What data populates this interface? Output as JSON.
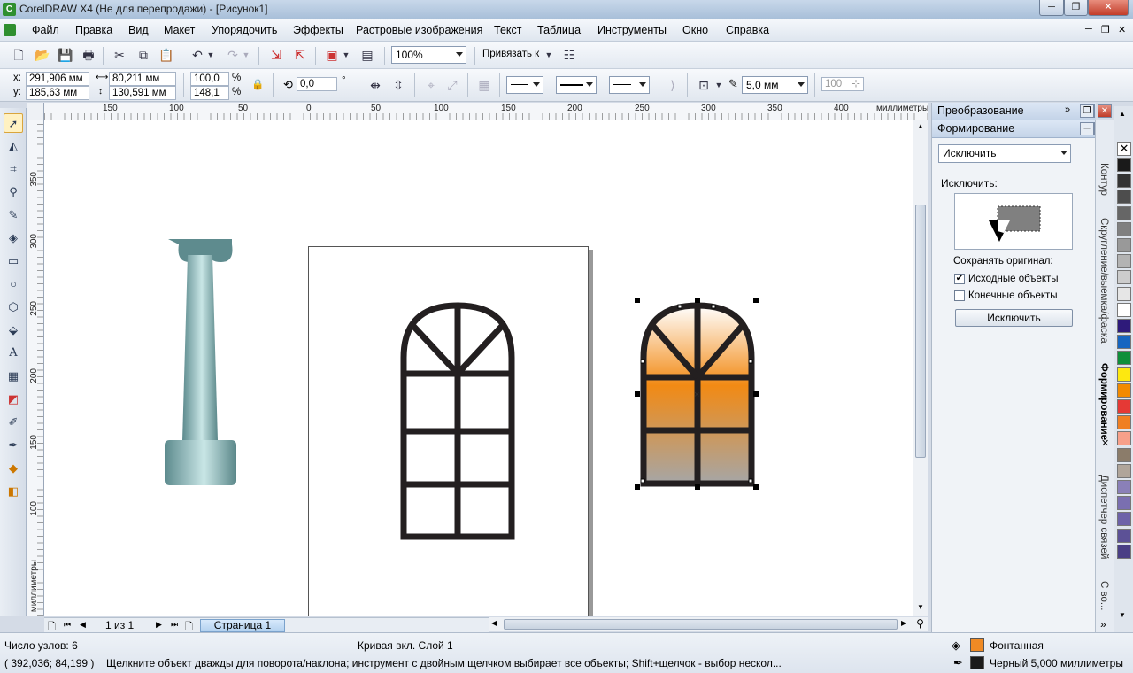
{
  "window": {
    "title": "CorelDRAW X4 (Не для перепродажи) - [Рисунок1]",
    "controls": [
      "─",
      "❐",
      "✕"
    ],
    "doc_controls": [
      "─",
      "❐",
      "✕"
    ]
  },
  "menu": [
    "Файл",
    "Правка",
    "Вид",
    "Макет",
    "Упорядочить",
    "Эффекты",
    "Растровые изображения",
    "Текст",
    "Таблица",
    "Инструменты",
    "Окно",
    "Справка"
  ],
  "toolbar": {
    "zoom": "100%",
    "snap_label": "Привязать к"
  },
  "property_bar": {
    "x_label": "x:",
    "x_value": "291,906 мм",
    "y_label": "y:",
    "y_value": "185,63 мм",
    "width_value": "80,211 мм",
    "height_value": "130,591 мм",
    "scale_x": "100,0",
    "scale_y": "148,1",
    "percent": "%",
    "rotation": "0,0",
    "degree": "°",
    "outline_width": "5,0 мм",
    "corner_value": "100"
  },
  "ruler": {
    "top_ticks": [
      "150",
      "100",
      "50",
      "0",
      "50",
      "100",
      "150",
      "200",
      "250",
      "300",
      "350",
      "400"
    ],
    "top_unit": "миллиметры",
    "left_ticks": [
      "350",
      "300",
      "250",
      "200",
      "150",
      "100"
    ],
    "left_unit": "миллиметры"
  },
  "page_nav": {
    "counter": "1 из 1",
    "tab": "Страница 1"
  },
  "docker": {
    "transform_title": "Преобразование",
    "shaping_title": "Формирование",
    "operation": "Исключить",
    "operation_label": "Исключить:",
    "keep_label": "Сохранять оригинал:",
    "source_label": "Исходные объекты",
    "source_checked": true,
    "target_label": "Конечные объекты",
    "target_checked": false,
    "apply_button": "Исключить"
  },
  "side_tabs": [
    "Контур",
    "Скругление/выемка/фаска",
    "Формирование",
    "Диспетчер связей",
    "С во..."
  ],
  "palette": [
    "#1a1a1a",
    "#333333",
    "#4d4d4d",
    "#666666",
    "#808080",
    "#999999",
    "#b3b3b3",
    "#cccccc",
    "#e6e6e6",
    "#ffffff",
    "#2e1a7a",
    "#1565c0",
    "#0f8f3a",
    "#fde810",
    "#f28a00",
    "#e53935",
    "#f07f22",
    "#f7a08a",
    "#8b7c6a",
    "#b0a59a",
    "#8a80b8",
    "#7a6fb0",
    "#6d62a8",
    "#5c5196",
    "#4a3f85"
  ],
  "status": {
    "nodes": "Число узлов: 6",
    "object_info": "Кривая вкл. Слой 1",
    "coords": "( 392,036; 84,199 )",
    "hint": "Щелкните объект дважды для поворота/наклона; инструмент с двойным щелчком выбирает все объекты; Shift+щелчок - выбор нескол...",
    "fill_label": "Фонтанная",
    "outline_label": "Черный  5,000 миллиметры",
    "fill_color": "#f08a24",
    "outline_color": "#1a1a1a"
  }
}
